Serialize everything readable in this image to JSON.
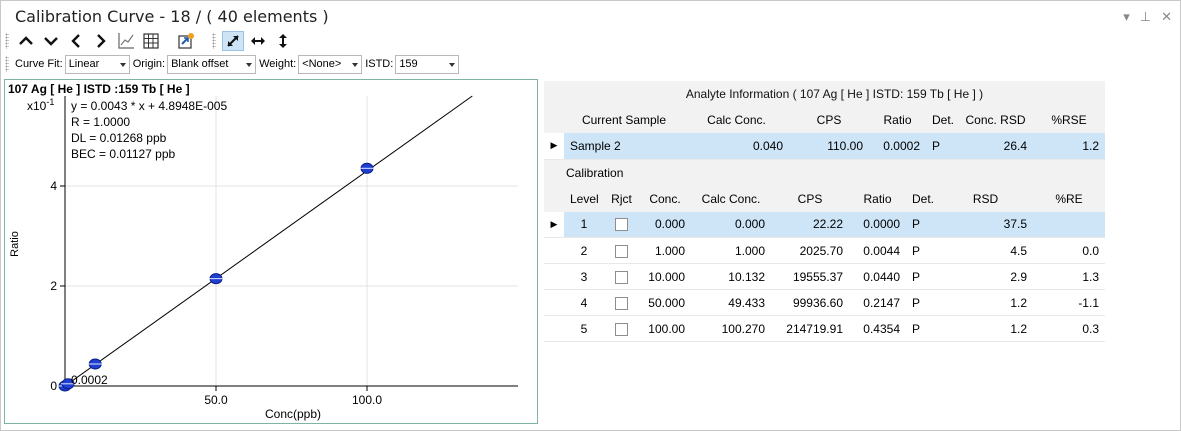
{
  "window": {
    "title": "Calibration Curve -  18 / ( 40 elements )",
    "controls": {
      "dropdown": "▾",
      "pin": "⊥",
      "close": "✕"
    }
  },
  "toolbar2": {
    "curve_fit_label": "Curve Fit:",
    "curve_fit_value": "Linear",
    "origin_label": "Origin:",
    "origin_value": "Blank offset",
    "weight_label": "Weight:",
    "weight_value": "<None>",
    "istd_label": "ISTD:",
    "istd_value": "159"
  },
  "chart": {
    "header": "107  Ag  [ He ]  ISTD :159  Tb  [ He ]",
    "multiplier_prefix": "x10",
    "multiplier_exp": "-1",
    "equation_lines": [
      "y = 0.0043 * x   + 4.8948E-005",
      "R =  1.0000",
      "DL = 0.01268 ppb",
      "BEC = 0.01127 ppb"
    ],
    "point_label": "0.0002"
  },
  "chart_data": {
    "type": "scatter",
    "xlabel": "Conc(ppb)",
    "ylabel": "Ratio",
    "xlim": [
      0,
      150
    ],
    "ylim": [
      0,
      5.8
    ],
    "x_ticks": [
      "50.0",
      "100.0"
    ],
    "y_ticks": [
      "0",
      "2",
      "4"
    ],
    "y_multiplier": "x10^-1",
    "grid": true,
    "series": [
      {
        "x": [
          0,
          1,
          10,
          50,
          100
        ],
        "y": [
          0.0,
          0.044,
          0.44,
          2.147,
          4.354
        ]
      }
    ],
    "fit_line": {
      "slope": 0.0043,
      "intercept": 4.8948e-05
    }
  },
  "analyte": {
    "title": "Analyte Information ( 107  Ag  [ He ]  ISTD: 159  Tb  [ He ] )",
    "headers": [
      "Current Sample",
      "Calc Conc.",
      "CPS",
      "Ratio",
      "Det.",
      "Conc. RSD",
      "%RSE"
    ],
    "row": {
      "indicator": "▶",
      "sample": "Sample 2",
      "calc": "0.040",
      "cps": "110.00",
      "ratio": "0.0002",
      "det": "P",
      "rsd": "26.4",
      "rse": "1.2"
    }
  },
  "calibration": {
    "title": "Calibration",
    "headers": [
      "Level",
      "Rjct",
      "Conc.",
      "Calc Conc.",
      "CPS",
      "Ratio",
      "Det.",
      "RSD",
      "%RE"
    ],
    "rows": [
      {
        "indicator": "▶",
        "level": "1",
        "conc": "0.000",
        "calc": "0.000",
        "cps": "22.22",
        "ratio": "0.0000",
        "det": "P",
        "rsd": "37.5",
        "re": ""
      },
      {
        "indicator": "",
        "level": "2",
        "conc": "1.000",
        "calc": "1.000",
        "cps": "2025.70",
        "ratio": "0.0044",
        "det": "P",
        "rsd": "4.5",
        "re": "0.0"
      },
      {
        "indicator": "",
        "level": "3",
        "conc": "10.000",
        "calc": "10.132",
        "cps": "19555.37",
        "ratio": "0.0440",
        "det": "P",
        "rsd": "2.9",
        "re": "1.3"
      },
      {
        "indicator": "",
        "level": "4",
        "conc": "50.000",
        "calc": "49.433",
        "cps": "99936.60",
        "ratio": "0.2147",
        "det": "P",
        "rsd": "1.2",
        "re": "-1.1"
      },
      {
        "indicator": "",
        "level": "5",
        "conc": "100.00",
        "calc": "100.270",
        "cps": "214719.91",
        "ratio": "0.4354",
        "det": "P",
        "rsd": "1.2",
        "re": "0.3"
      }
    ]
  }
}
